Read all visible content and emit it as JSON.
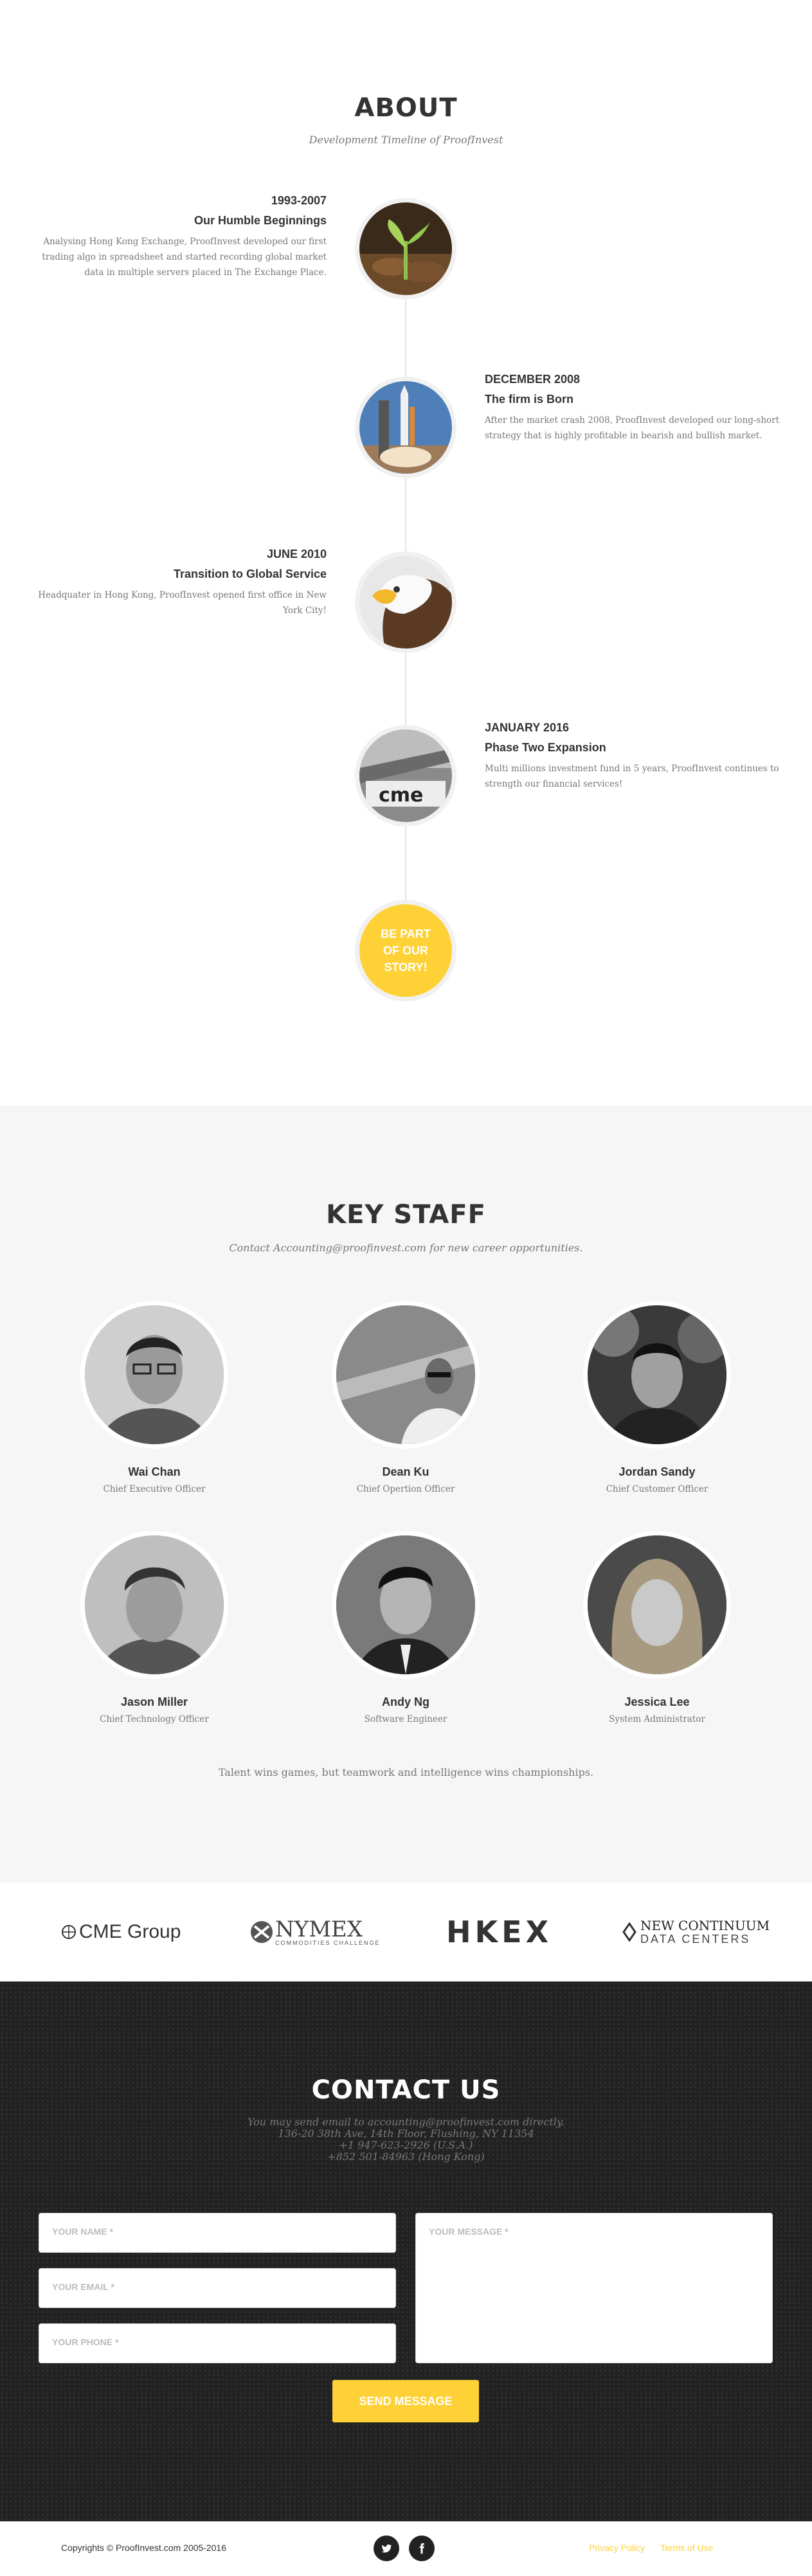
{
  "about": {
    "title": "ABOUT",
    "subtitle": "Development Timeline of ProofInvest",
    "timeline": [
      {
        "date": "1993-2007",
        "heading": "Our Humble Beginnings",
        "description": "Analysing Hong Kong Exchange, ProofInvest developed our first trading algo in spreadsheet and started recording global market data in multiple servers placed in The Exchange Place.",
        "image": "seedling-photo"
      },
      {
        "date": "DECEMBER 2008",
        "heading": "The firm is Born",
        "description": "After the market crash 2008, ProofInvest developed our long-short strategy that is highly profitable in bearish and bullish market.",
        "image": "rocket-launch-photo"
      },
      {
        "date": "JUNE 2010",
        "heading": "Transition to Global Service",
        "description": "Headquater in Hong Kong, ProofInvest opened first office in New York City!",
        "image": "eagle-photo"
      },
      {
        "date": "JANUARY 2016",
        "heading": "Phase Two Expansion",
        "description": "Multi millions investment fund in 5 years, ProofInvest continues to strength our financial services!",
        "image": "cme-building-photo"
      }
    ],
    "cta": "BE PART OF OUR STORY!"
  },
  "staff": {
    "title": "KEY STAFF",
    "subtitle": "Contact Accounting@proofinvest.com for new career opportunities.",
    "members": [
      {
        "name": "Wai Chan",
        "role": "Chief Executive Officer"
      },
      {
        "name": "Dean Ku",
        "role": "Chief Opertion Officer"
      },
      {
        "name": "Jordan Sandy",
        "role": "Chief Customer Officer"
      },
      {
        "name": "Jason Miller",
        "role": "Chief Technology Officer"
      },
      {
        "name": "Andy Ng",
        "role": "Software Engineer"
      },
      {
        "name": "Jessica Lee",
        "role": "System Administrator"
      }
    ],
    "quote": "Talent wins games, but teamwork and intelligence wins championships."
  },
  "logos": {
    "cme": "CME Group",
    "nymex": "NYMEX",
    "nymex_sub": "COMMODITIES CHALLENGE",
    "hkex": "HKEX",
    "nc_top": "NEW CONTINUUM",
    "nc_bottom": "DATA CENTERS"
  },
  "contact": {
    "title": "CONTACT US",
    "lines": [
      "You may send email to accounting@proofinvest.com directly.",
      "136-20 38th Ave, 14th Floor, Flushing, NY 11354",
      "+1 947-623-2926 (U.S.A.)",
      "+852 501-84963 (Hong Kong)"
    ],
    "name_placeholder": "YOUR NAME *",
    "email_placeholder": "YOUR EMAIL *",
    "phone_placeholder": "YOUR PHONE *",
    "message_placeholder": "YOUR MESSAGE *",
    "send_label": "SEND MESSAGE"
  },
  "footer": {
    "copyright": "Copyrights © ProofInvest.com 2005-2016",
    "privacy": "Privacy Policy",
    "terms": "Terms of Use",
    "social_icons": [
      "twitter-icon",
      "facebook-icon"
    ]
  },
  "colors": {
    "accent": "#fed136",
    "dark": "#222222",
    "light_bg": "#f6f6f6"
  }
}
